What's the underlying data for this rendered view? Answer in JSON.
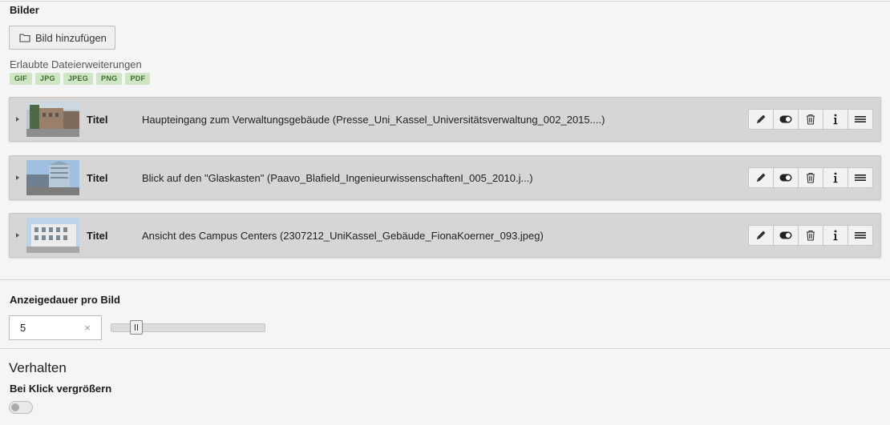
{
  "images_section": {
    "label": "Bilder",
    "add_button_label": "Bild hinzufügen",
    "allowed_extensions_label": "Erlaubte Dateierweiterungen",
    "extensions": [
      "GIF",
      "JPG",
      "JPEG",
      "PNG",
      "PDF"
    ]
  },
  "files": [
    {
      "title_label": "Titel",
      "description": "Haupteingang zum Verwaltungsgebäude (Presse_Uni_Kassel_Universitätsverwaltung_002_2015....)"
    },
    {
      "title_label": "Titel",
      "description": "Blick auf den \"Glaskasten\" (Paavo_Blafield_IngenieurwissenschaftenI_005_2010.j...)"
    },
    {
      "title_label": "Titel",
      "description": "Ansicht des Campus Centers (2307212_UniKassel_Gebäude_FionaKoerner_093.jpeg)"
    }
  ],
  "duration": {
    "label": "Anzeigedauer pro Bild",
    "value": "5",
    "clear_symbol": "×"
  },
  "behavior": {
    "heading": "Verhalten",
    "zoom_label": "Bei Klick vergrößern",
    "zoom_enabled": false
  },
  "colors": {
    "background": "#f5f5f5",
    "row_background": "#d6d6d6",
    "badge_background": "#cfe6c6",
    "badge_text": "#3e6b2f"
  }
}
